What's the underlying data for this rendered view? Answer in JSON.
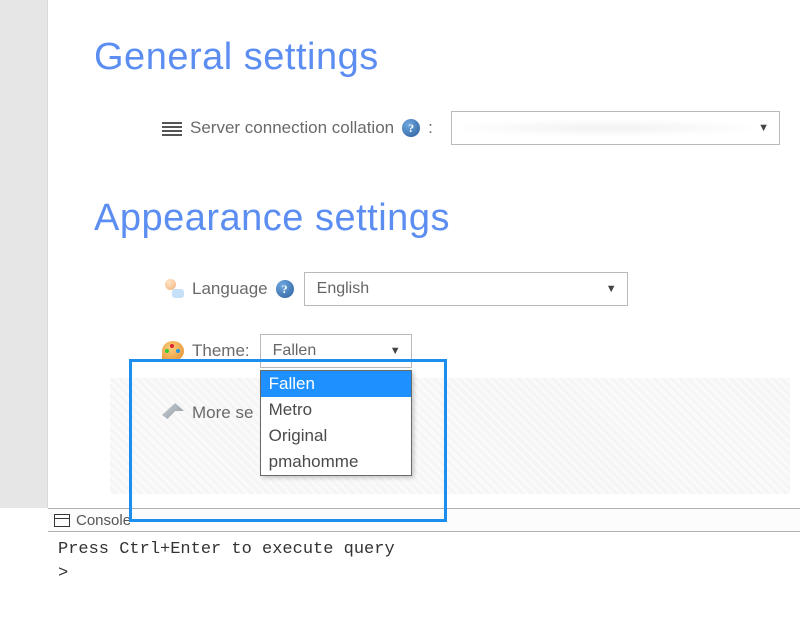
{
  "headings": {
    "general": "General settings",
    "appearance": "Appearance settings"
  },
  "collation": {
    "label": "Server connection collation",
    "selected": ""
  },
  "language": {
    "label": "Language",
    "selected": "English"
  },
  "theme": {
    "label": "Theme:",
    "selected": "Fallen",
    "options": [
      "Fallen",
      "Metro",
      "Original",
      "pmahomme"
    ]
  },
  "more_settings": {
    "label": "More se"
  },
  "console": {
    "title": "Console",
    "hint": "Press Ctrl+Enter to execute query",
    "prompt": ">"
  },
  "help_glyph": "?"
}
